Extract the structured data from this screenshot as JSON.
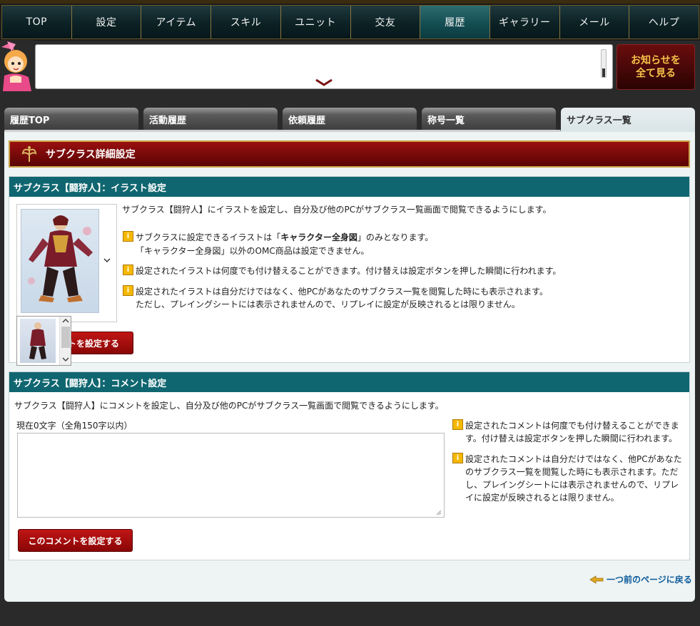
{
  "nav": {
    "items": [
      "TOP",
      "設定",
      "アイテム",
      "スキル",
      "ユニット",
      "交友",
      "履歴",
      "ギャラリー",
      "メール",
      "ヘルプ"
    ],
    "active_index": 6
  },
  "notice": {
    "button_line1": "お知らせを",
    "button_line2": "全て見る"
  },
  "tabs": {
    "items": [
      "履歴TOP",
      "活動履歴",
      "依頼履歴",
      "称号一覧",
      "サブクラス一覧"
    ],
    "active_index": 4
  },
  "page_header": "サブクラス詳細設定",
  "illust_section": {
    "title": "サブクラス【闘狩人】：イラスト設定",
    "intro": "サブクラス【闘狩人】にイラストを設定し、自分及び他のPCがサブクラス一覧画面で閲覧できるようにします。",
    "note1_a": "サブクラスに設定できるイラストは「",
    "note1_bold": "キャラクター全身図",
    "note1_b": "」のみとなります。",
    "note1_line2": "「キャラクター全身図」以外のOMC商品は設定できません。",
    "note2": "設定されたイラストは何度でも付け替えることができます。付け替えは設定ボタンを押した瞬間に行われます。",
    "note3_line1": "設定されたイラストは自分だけではなく、他PCがあなたのサブクラス一覧を閲覧した時にも表示されます。",
    "note3_line2": "ただし、プレイングシートには表示されませんので、リプレイに設定が反映されるとは限りません。",
    "button_label": "トを設定する"
  },
  "comment_section": {
    "title": "サブクラス【闘狩人】：コメント設定",
    "intro": "サブクラス【闘狩人】にコメントを設定し、自分及び他のPCがサブクラス一覧画面で閲覧できるようにします。",
    "counter": "現在0文字（全角150字以内）",
    "textarea_value": "",
    "note1_line1": "設定されたコメントは何度でも付け替えることができま",
    "note1_line2": "す。付け替えは設定ボタンを押した瞬間に行われます。",
    "note2_line1": "設定されたコメントは自分だけではなく、他PCがあなた",
    "note2_line2": "のサブクラス一覧を閲覧した時にも表示されます。ただ",
    "note2_line3": "し、プレイングシートには表示されませんので、リプレ",
    "note2_line4": "イに設定が反映されるとは限りません。",
    "button_label": "このコメントを設定する"
  },
  "back_link": "一つ前のページに戻る",
  "colors": {
    "section_head": "#0f6670",
    "header_red": "#8a0a0a",
    "button_red": "#b00e0e",
    "link_blue": "#0a5a9a"
  }
}
